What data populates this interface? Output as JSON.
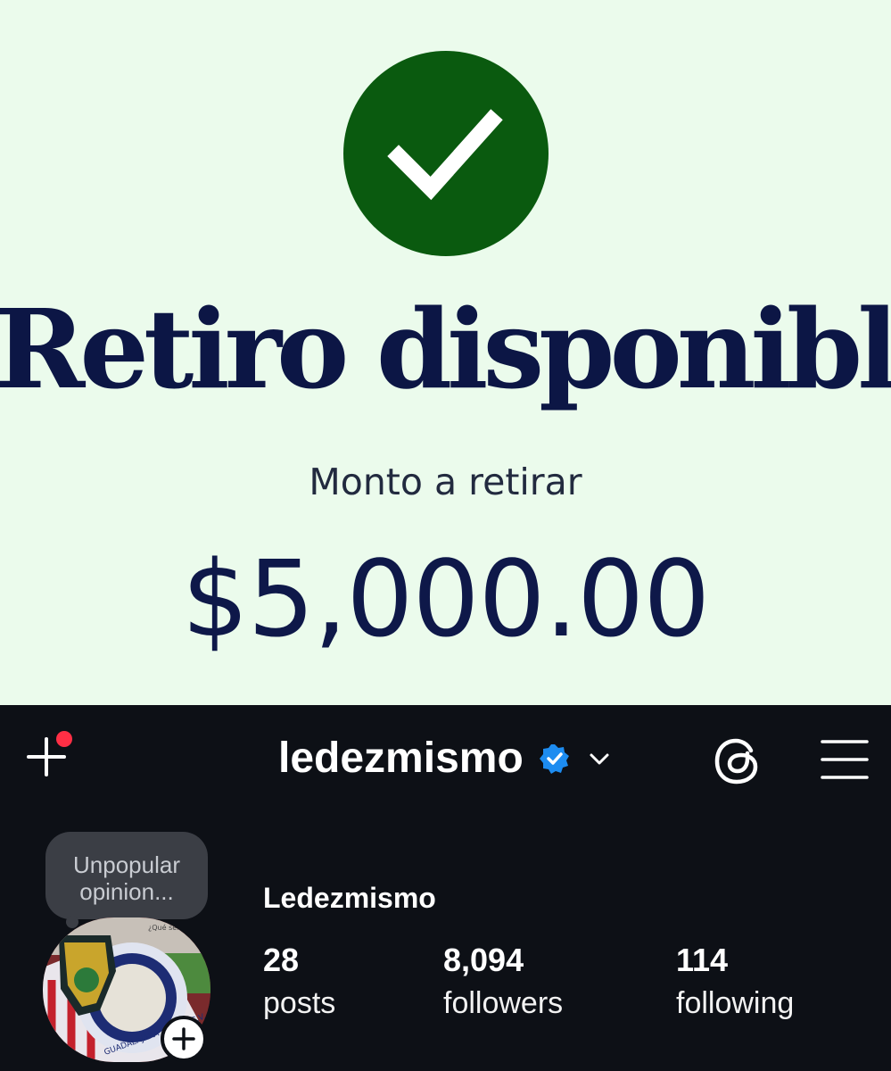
{
  "withdrawal": {
    "icon": "check-circle-icon",
    "accent_color": "#0a5a0f",
    "title": "Retiro disponible",
    "subtitle": "Monto a retirar",
    "amount": "$5,000.00"
  },
  "profile": {
    "username": "ledezmismo",
    "verified": true,
    "display_name": "Ledezmismo",
    "note": {
      "line1": "Unpopular",
      "line2": "opinion..."
    },
    "avatar_text": [
      "¿Qué sentiste",
      "GUADALAJARA S.A. DE C.V."
    ],
    "stats": [
      {
        "value": "28",
        "label": "posts"
      },
      {
        "value": "8,094",
        "label": "followers"
      },
      {
        "value": "114",
        "label": "following"
      }
    ],
    "icons": {
      "new_post": "plus-icon",
      "notification": "red-dot-icon",
      "verified": "verified-badge-icon",
      "account_switcher": "chevron-down-icon",
      "threads": "threads-icon",
      "menu": "hamburger-menu-icon",
      "add_story": "plus-circle-icon"
    },
    "colors": {
      "background": "#0d1016",
      "verified": "#1d8cf0",
      "notification": "#ff2f45"
    }
  }
}
